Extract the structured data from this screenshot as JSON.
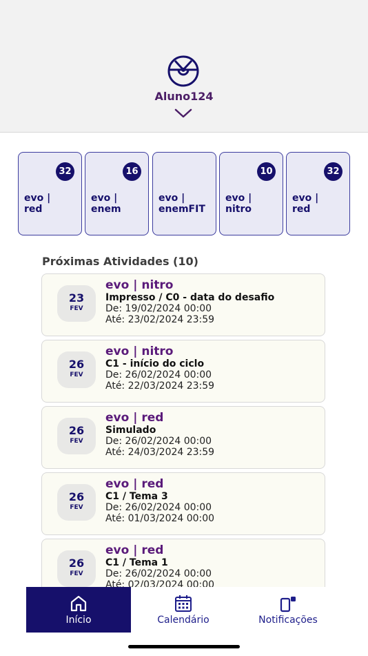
{
  "header": {
    "username": "Aluno124"
  },
  "cards": [
    {
      "label": "evo |\nred",
      "badge": "32"
    },
    {
      "label": "evo |\nenem",
      "badge": "16"
    },
    {
      "label": "evo |\nenemFIT",
      "badge": ""
    },
    {
      "label": "evo |\nnitro",
      "badge": "10"
    },
    {
      "label": "evo |\nred",
      "badge": "32"
    }
  ],
  "activities_section": {
    "title": "Próximas Atividades (10)"
  },
  "activities": [
    {
      "day": "23",
      "month": "FEV",
      "course": "evo | nitro",
      "title": "Impresso / C0 - data do desafio",
      "start": "De: 19/02/2024 00:00",
      "end": "Até: 23/02/2024 23:59"
    },
    {
      "day": "26",
      "month": "FEV",
      "course": "evo | nitro",
      "title": "C1 - início do ciclo",
      "start": "De: 26/02/2024 00:00",
      "end": "Até: 22/03/2024 23:59"
    },
    {
      "day": "26",
      "month": "FEV",
      "course": "evo | red",
      "title": "Simulado",
      "start": "De: 26/02/2024 00:00",
      "end": "Até: 24/03/2024 23:59"
    },
    {
      "day": "26",
      "month": "FEV",
      "course": "evo | red",
      "title": "C1 / Tema 3",
      "start": "De: 26/02/2024 00:00",
      "end": "Até: 01/03/2024 00:00"
    },
    {
      "day": "26",
      "month": "FEV",
      "course": "evo | red",
      "title": "C1 / Tema 1",
      "start": "De: 26/02/2024 00:00",
      "end": "Até: 02/03/2024 00:00"
    }
  ],
  "tabbar": {
    "tabs": [
      {
        "label": "Início",
        "icon": "home-icon",
        "active": true
      },
      {
        "label": "Calendário",
        "icon": "calendar-icon",
        "active": false
      },
      {
        "label": "Notificações",
        "icon": "notifications-icon",
        "active": false
      }
    ]
  },
  "colors": {
    "brand_navy": "#16106b",
    "brand_purple": "#5a1a7a",
    "card_bg": "#e9e9f5",
    "activity_bg": "#fbfbf3"
  }
}
